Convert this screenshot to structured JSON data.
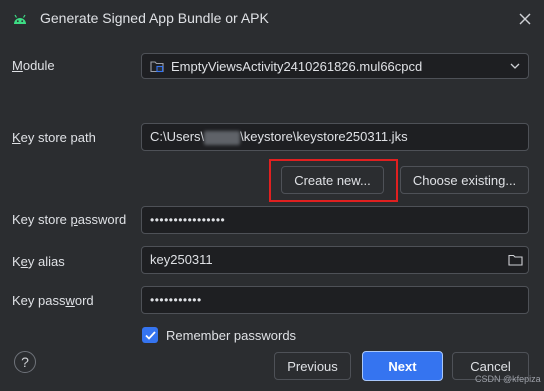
{
  "window": {
    "title": "Generate Signed App Bundle or APK",
    "app_icon": "android-icon",
    "close_icon": "close-icon"
  },
  "module": {
    "label_underlined": "M",
    "label_rest": "odule",
    "value": "EmptyViewsActivity2410261826.mul66cpcd",
    "icon": "module-folder-icon"
  },
  "keystore": {
    "label_underlined": "K",
    "label_rest": "ey store path",
    "path_prefix": "C:\\Users\\",
    "path_suffix": "\\keystore\\keystore250311.jks",
    "create_new_label": "Create new...",
    "choose_existing_label": "Choose existing...",
    "password_label_pre": "Key store ",
    "password_label_underlined": "p",
    "password_label_post": "assword",
    "password_masked": "••••••••••••••••"
  },
  "key": {
    "alias_label_pre": "K",
    "alias_label_underlined": "e",
    "alias_label_post": "y alias",
    "alias_value": "key250311",
    "password_label_pre": "Key pass",
    "password_label_underlined": "w",
    "password_label_post": "ord",
    "password_masked": "•••••••••••"
  },
  "remember": {
    "label": "Remember passwords",
    "checked": true
  },
  "footer": {
    "help_label": "?",
    "previous_label": "Previous",
    "next_label": "Next",
    "cancel_label": "Cancel"
  },
  "watermark": "CSDN @kfepiza",
  "colors": {
    "background": "#2b2d30",
    "field": "#1e1f22",
    "accent": "#3574f0",
    "highlight": "#e02020"
  }
}
